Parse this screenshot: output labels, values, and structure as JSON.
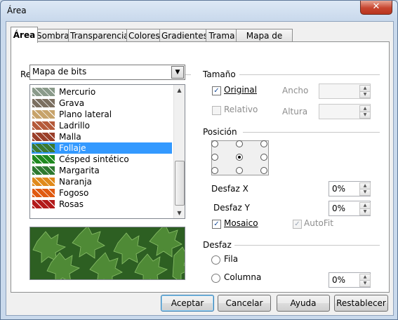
{
  "window": {
    "title": "Área",
    "close_symbol": "✕"
  },
  "tabs": [
    "Área",
    "Sombra",
    "Transparencia",
    "Colores",
    "Gradientes",
    "Trama",
    "Mapa de bits"
  ],
  "relleno": {
    "label": "Relleno",
    "selected": "Mapa de bits",
    "items": [
      "Mercurio",
      "Grava",
      "Plano lateral",
      "Ladrillo",
      "Malla",
      "Follaje",
      "Césped sintético",
      "Margarita",
      "Naranja",
      "Fogoso",
      "Rosas"
    ],
    "selected_item": "Follaje",
    "thumb_colors": [
      "#8a9a8a",
      "#7b6f60",
      "#c7a36b",
      "#b55a3a",
      "#9a3f2a",
      "#3d7a2e",
      "#1f8a1f",
      "#2f7a30",
      "#e08a1c",
      "#e05a10",
      "#b31a1a"
    ]
  },
  "tamano": {
    "label": "Tamaño",
    "original": "Original",
    "relativo": "Relativo",
    "ancho": "Ancho",
    "altura": "Altura"
  },
  "posicion": {
    "label": "Posición",
    "desfaz_x": "Desfaz X",
    "desfaz_x_value": "0%",
    "desfaz_y": "Desfaz Y",
    "desfaz_y_value": "0%",
    "mosaico": "Mosaico",
    "autofit": "AutoFit"
  },
  "desfaz": {
    "label": "Desfaz",
    "fila": "Fila",
    "columna": "Columna",
    "value": "0%"
  },
  "buttons": {
    "aceptar": "Aceptar",
    "cancelar": "Cancelar",
    "ayuda": "Ayuda",
    "restablecer": "Restablecer"
  },
  "colors": {
    "selection": "#3399ff",
    "check": "#1b4f9a",
    "close": "#c7452f"
  }
}
